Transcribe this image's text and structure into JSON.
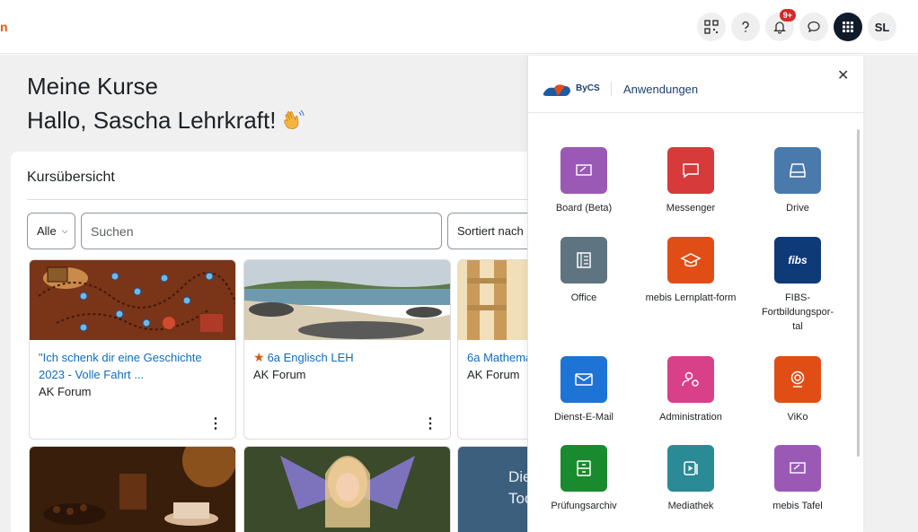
{
  "navbar": {
    "brand_fragment": "n",
    "notification_count": "9+",
    "avatar_initials": "SL"
  },
  "page": {
    "title": "Meine Kurse",
    "greeting": "Hallo, Sascha Lehrkraft!"
  },
  "overview": {
    "title": "Kursübersicht",
    "filter_value": "Alle",
    "search_placeholder": "Suchen",
    "sort_label": "Sortiert nach"
  },
  "courses": [
    {
      "name": "\"Ich schenk dir eine Geschichte 2023 - Volle Fahrt ...",
      "category": "AK Forum",
      "starred": false
    },
    {
      "name": "6a Englisch LEH",
      "category": "AK Forum",
      "starred": true
    },
    {
      "name": "6a Mathema",
      "category": "AK Forum",
      "starred": false
    },
    {
      "name": "",
      "category": "",
      "starred": false
    },
    {
      "name": "",
      "category": "",
      "starred": false
    },
    {
      "name": "",
      "category": "",
      "starred": false
    }
  ],
  "course_image_text": "Die\nTod",
  "apps_panel": {
    "brand": "ByCS",
    "title": "Anwendungen",
    "apps": [
      {
        "label": "Board (Beta)",
        "icon": "board-icon",
        "color": "#9b59b6"
      },
      {
        "label": "Messenger",
        "icon": "messenger-icon",
        "color": "#d63a3a"
      },
      {
        "label": "Drive",
        "icon": "drive-icon",
        "color": "#4a7aab"
      },
      {
        "label": "Office",
        "icon": "office-icon",
        "color": "#5e7480"
      },
      {
        "label": "mebis Lernplatt-form",
        "icon": "mortarboard-icon",
        "color": "#e04e16"
      },
      {
        "label": "FIBS-Fortbildungspor-tal",
        "icon": "fibs-logo-icon",
        "color": "#0e3a78"
      },
      {
        "label": "Dienst-E-Mail",
        "icon": "mail-icon",
        "color": "#1e74d6"
      },
      {
        "label": "Administration",
        "icon": "admin-icon",
        "color": "#d8408a"
      },
      {
        "label": "ViKo",
        "icon": "webcam-icon",
        "color": "#e04e16"
      },
      {
        "label": "Prüfungsarchiv",
        "icon": "archive-icon",
        "color": "#1a8a2e"
      },
      {
        "label": "Mediathek",
        "icon": "media-icon",
        "color": "#2a8a96"
      },
      {
        "label": "mebis Tafel",
        "icon": "board-icon",
        "color": "#9b59b6"
      }
    ]
  },
  "fibs_logo_text": "fibs"
}
